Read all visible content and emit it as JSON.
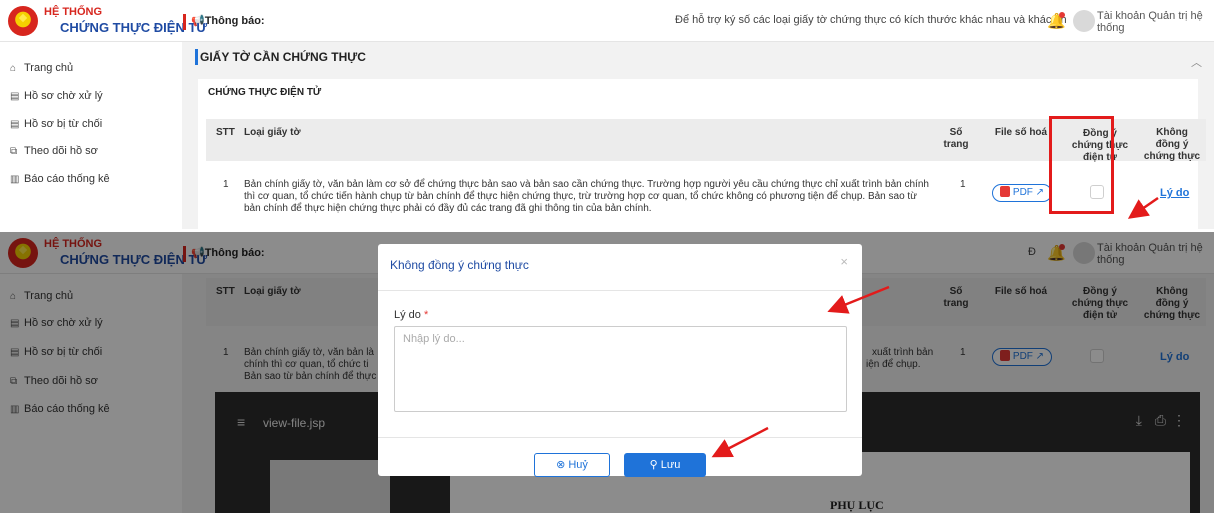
{
  "app": {
    "brand_line1": "HỆ THỐNG",
    "brand_line2": "CHỨNG THỰC ĐIỆN TỬ",
    "notice_label": "Thông báo:",
    "notice_text_top": "Để hỗ trợ ký số các loại giấy tờ chứng thực có kích thước khác nhau và khác ph",
    "notice_text_bottom": "Đ",
    "account_label": "Tài khoản Quản trị hệ thống"
  },
  "sidebar": {
    "items": [
      {
        "label": "Trang chủ",
        "icon": "home-icon"
      },
      {
        "label": "Hồ sơ chờ xử lý",
        "icon": "document-icon"
      },
      {
        "label": "Hồ sơ bị từ chối",
        "icon": "document-icon"
      },
      {
        "label": "Theo dõi hồ sơ",
        "icon": "track-icon"
      },
      {
        "label": "Báo cáo thống kê",
        "icon": "chart-icon"
      }
    ]
  },
  "section": {
    "title": "GIẤY TỜ CẦN CHỨNG THỰC",
    "subtitle": "CHỨNG THỰC ĐIỆN TỬ"
  },
  "table": {
    "headers": {
      "stt": "STT",
      "type": "Loại giấy tờ",
      "pages": "Số trang",
      "file": "File số hoá",
      "agree": "Đồng ý chứng thực điện tử",
      "disagree": "Không đồng ý chứng thực"
    },
    "rows": [
      {
        "stt": "1",
        "type_full": "Bản chính giấy tờ, văn bản làm cơ sở để chứng thực bản sao và bản sao cần chứng thực. Trường hợp người yêu cầu chứng thực chỉ xuất trình bản chính thì cơ quan, tổ chức tiến hành chụp từ bản chính để thực hiện chứng thực, trừ trường hợp cơ quan, tổ chức không có phương tiện để chụp. Bản sao từ bản chính để thực hiện chứng thực phải có đầy đủ các trang đã ghi thông tin của bản chính.",
        "type_left_line1": "Bản chính giấy tờ, văn bản là",
        "type_left_line2": "chính thì cơ quan, tổ chức ti",
        "type_left_line3": "Bản sao từ bản chính để thực",
        "type_right_line1": "xuất trình bản",
        "type_right_line2": "iện để chụp.",
        "pages": "1",
        "file_label": "PDF",
        "reason_link": "Lý do"
      }
    ]
  },
  "modal": {
    "title": "Không đồng ý chứng thực",
    "field_label": "Lý do",
    "required_mark": "*",
    "placeholder": "Nhập lý do...",
    "cancel_label": "Huỷ",
    "save_label": "Lưu"
  },
  "viewer": {
    "file_name": "view-file.jsp",
    "doc_heading": "PHỤ LỤC"
  },
  "colors": {
    "brand_red": "#d7261e",
    "brand_blue": "#1f4ba3",
    "accent_blue": "#1f73d9",
    "highlight_red": "#e31b1b"
  }
}
